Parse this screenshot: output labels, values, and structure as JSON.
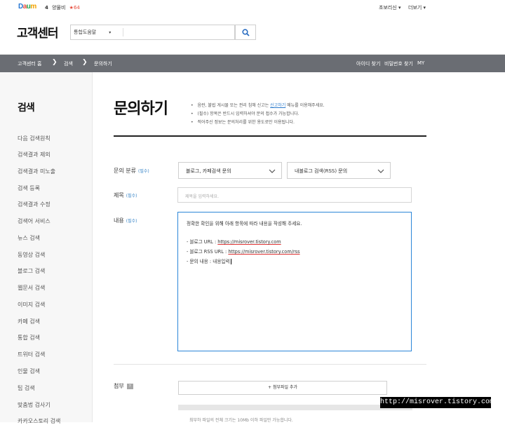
{
  "header": {
    "logo": [
      "D",
      "a",
      "u",
      "m"
    ],
    "logo_colors": [
      "#2476d3",
      "#e74c3c",
      "#1fa84a",
      "#f2a200"
    ],
    "user_number": "4",
    "user_name": "양물비",
    "user_rank": "★64",
    "top_links": [
      "초보리신 ▾",
      "더보기 ▾"
    ],
    "service_title": "고객센터",
    "search": {
      "scope": "통합도움말",
      "caret": "▾",
      "value": ""
    }
  },
  "navbar": {
    "breadcrumbs": [
      "고객센터 홈",
      "검색",
      "문의하기"
    ],
    "separator": "❯",
    "right_links": [
      "아이디 찾기",
      "비밀번호 찾기",
      "MY"
    ]
  },
  "sidebar": {
    "title": "검색",
    "items": [
      "다음 검색원칙",
      "검색결과 제외",
      "검색결과 미노출",
      "검색 등록",
      "검색결과 수정",
      "검색어 서비스",
      "뉴스 검색",
      "동영상 검색",
      "블로그 검색",
      "웹문서 검색",
      "이미지 검색",
      "카페 검색",
      "통합 검색",
      "트위터 검색",
      "인물 검색",
      "팁 검색",
      "맞춤법 검사기",
      "카카오스토리 검색"
    ]
  },
  "main": {
    "title": "문의하기",
    "notices": [
      {
        "bullet": "•",
        "before": "음란, 불법 게시물 또는 권리 침해 신고는 ",
        "link": "신고하기",
        "after": " 메뉴를 이용해주세요."
      },
      {
        "bullet": "•",
        "before": "(필수) 항목은 반드시 입력하셔야 문의 접수가 가능합니다.",
        "link": "",
        "after": ""
      },
      {
        "bullet": "•",
        "before": "적어주신 정보는 문의처리를 위한 용도로만 이용됩니다.",
        "link": "",
        "after": ""
      }
    ],
    "form": {
      "category_label": "문의 분류",
      "required_tag": "(필수)",
      "category_1": "블로그, 카페검색 문의",
      "category_2": "내블로그 검색(RSS) 문의",
      "subject_label": "제목",
      "subject_placeholder": "제목을 입력하세요.",
      "content_label": "내용",
      "content_lines": [
        {
          "pre": "정확한 확인을 위해 아래 항목에 따라 내용을 작성해 주세요.",
          "url": ""
        },
        {
          "pre": "",
          "url": ""
        },
        {
          "pre": "- 블로그 URL : ",
          "url": "https://misrover.tistory.com"
        },
        {
          "pre": "- 블로그 RSS URL : ",
          "url": "https://misrover.tistory.com/rss"
        },
        {
          "pre": "- 문의 내용 : 내용입력",
          "url": ""
        }
      ],
      "attach_label": "첨부",
      "attach_help": "?",
      "attach_button": "+ 첨부파일 추가",
      "footnote": "최부하 파일의 전체 크기는 10Mb 이하 파일만 가능합니다."
    }
  },
  "watermark": "http://misrover.tistory.com"
}
